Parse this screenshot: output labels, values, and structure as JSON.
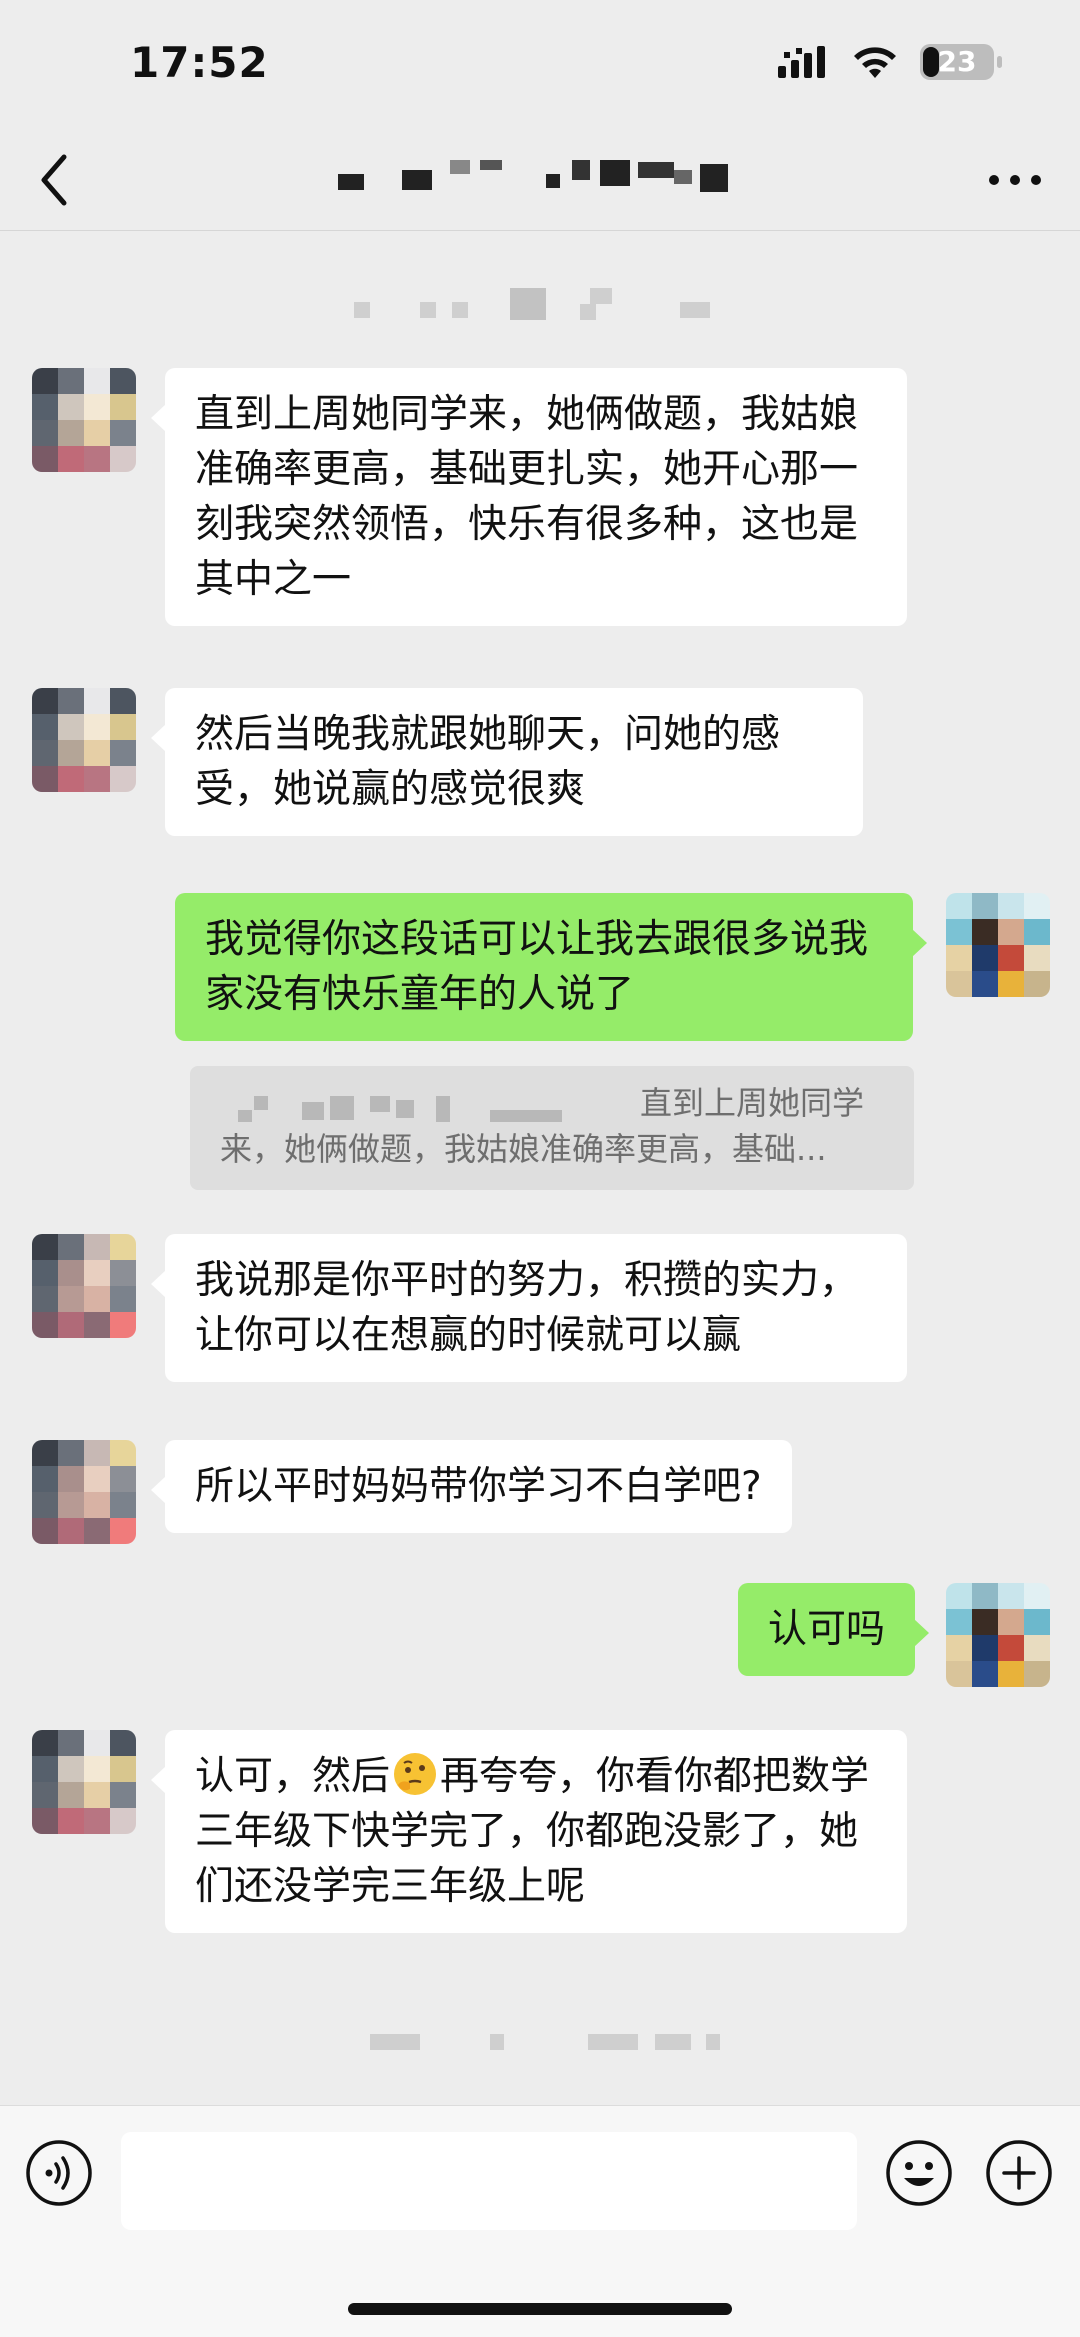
{
  "status_bar": {
    "time": "17:52",
    "battery_level": "23",
    "battery_fraction": 0.23,
    "signal_icon": "cellular-signal-icon",
    "wifi_icon": "wifi-icon"
  },
  "nav": {
    "back_icon": "chevron-left-icon",
    "title_obscured": true,
    "more_icon": "more-dots-icon"
  },
  "messages": [
    {
      "side": "left",
      "text": "直到上周她同学来，她俩做题，我姑娘准确率更高，基础更扎实，她开心那一刻我突然领悟，快乐有很多种，这也是其中之一"
    },
    {
      "side": "left",
      "text": "然后当晚我就跟她聊天，问她的感受，她说赢的感觉很爽"
    },
    {
      "side": "right",
      "text": "我觉得你这段话可以让我去跟很多说我家没有快乐童年的人说了"
    },
    {
      "side": "left",
      "text": "我说那是你平时的努力，积攒的实力，让你可以在想赢的时候就可以赢"
    },
    {
      "side": "left",
      "text": "所以平时妈妈带你学习不白学吧?"
    },
    {
      "side": "right",
      "text": "认可吗"
    },
    {
      "side": "left",
      "text_before": "认可，然后",
      "emoji": "thinking-face-emoji",
      "text_after": "再夸夸，你看你都把数学三年级下快学完了，你都跑没影了，她们还没学完三年级上呢"
    }
  ],
  "quote": {
    "line1": "直到上周她同学",
    "line2": "来，她俩做题，我姑娘准确率更高，基础..."
  },
  "input_bar": {
    "voice_icon": "voice-input-icon",
    "emoji_icon": "emoji-icon",
    "plus_icon": "plus-icon",
    "input_value": ""
  },
  "colors": {
    "background": "#ededed",
    "incoming_bubble": "#ffffff",
    "outgoing_bubble": "#95ec69",
    "quote_background": "#dedede"
  }
}
